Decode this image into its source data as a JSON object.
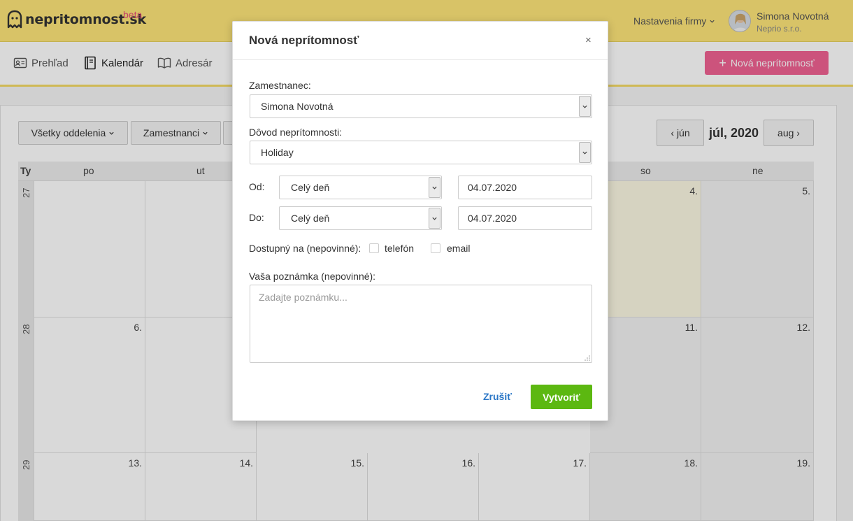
{
  "header": {
    "logo_text": "nepritomnost.sk",
    "beta_label": "beta",
    "company_menu": "Nastavenia firmy",
    "user_name": "Simona Novotná",
    "user_company": "Neprio s.r.o."
  },
  "nav": {
    "items": [
      {
        "label": "Prehľad",
        "icon": "id-card-icon"
      },
      {
        "label": "Kalendár",
        "icon": "notebook-icon"
      },
      {
        "label": "Adresár",
        "icon": "book-icon"
      }
    ],
    "new_absence_button": "Nová neprítomnosť"
  },
  "calendar": {
    "filters": {
      "departments": "Všetky oddelenia",
      "employees": "Zamestnanci"
    },
    "prev_month": "jún",
    "current_month": "júl, 2020",
    "next_month": "aug",
    "week_header": "Ty",
    "day_headers": [
      "po",
      "ut",
      "so",
      "ne"
    ],
    "weeks": [
      {
        "number": "27",
        "days": [
          "",
          "",
          "4.",
          "5."
        ]
      },
      {
        "number": "28",
        "days": [
          "6.",
          "",
          "11.",
          "12."
        ]
      },
      {
        "number": "29",
        "days": [
          "13.",
          "14.",
          "15.",
          "16.",
          "17.",
          "18.",
          "19."
        ]
      }
    ]
  },
  "modal": {
    "title": "Nová neprítomnosť",
    "close": "×",
    "employee_label": "Zamestnanec:",
    "employee_value": "Simona Novotná",
    "reason_label": "Dôvod neprítomnosti:",
    "reason_value": "Holiday",
    "from_label": "Od:",
    "from_period": "Celý deň",
    "from_date": "04.07.2020",
    "to_label": "Do:",
    "to_period": "Celý deň",
    "to_date": "04.07.2020",
    "available_label": "Dostupný na (nepovinné):",
    "phone_label": "telefón",
    "email_label": "email",
    "note_label": "Vaša poznámka (nepovinné):",
    "note_placeholder": "Zadajte poznámku...",
    "cancel_label": "Zrušiť",
    "create_label": "Vytvoriť"
  }
}
